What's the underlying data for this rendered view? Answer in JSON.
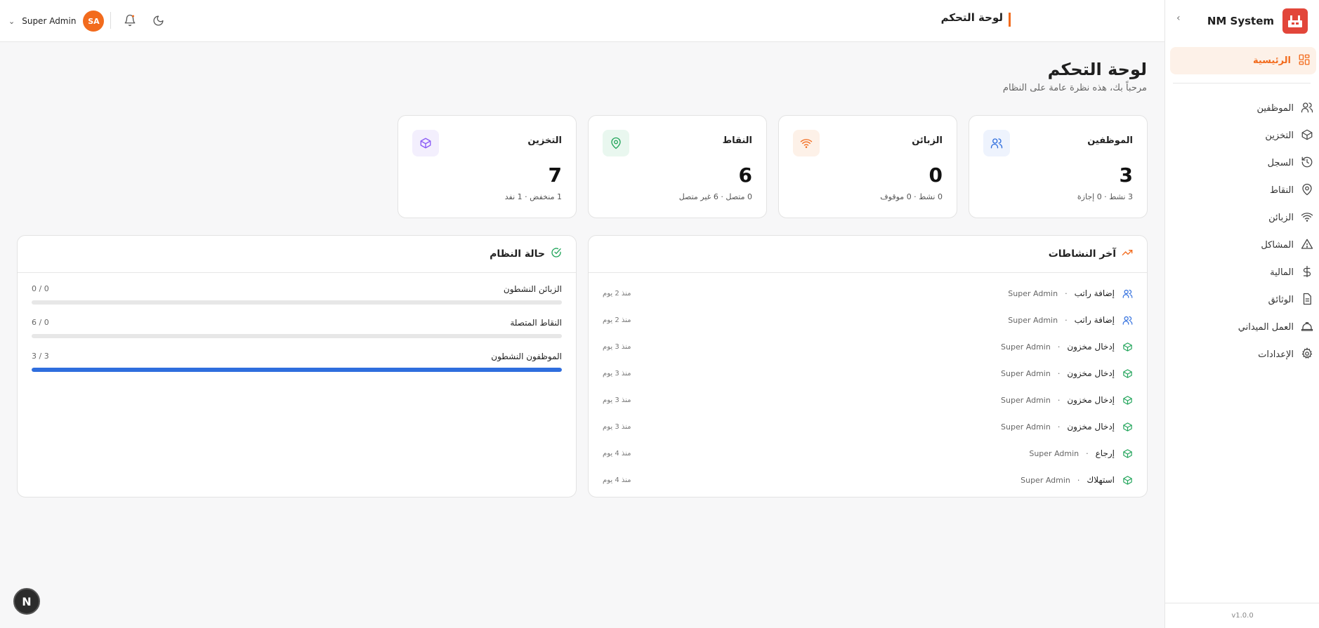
{
  "header": {
    "user_name": "Super Admin",
    "avatar_initials": "SA",
    "page_label": "لوحة التحكم"
  },
  "sidebar": {
    "brand": "NM System",
    "version": "v1.0.0",
    "items": [
      {
        "label": "الرئيسية",
        "icon": "dashboard-icon",
        "active": true
      },
      {
        "label": "الموظفين",
        "icon": "users-icon"
      },
      {
        "label": "التخزين",
        "icon": "box-icon"
      },
      {
        "label": "السجل",
        "icon": "history-icon"
      },
      {
        "label": "النقاط",
        "icon": "map-pin-icon"
      },
      {
        "label": "الزبائن",
        "icon": "wifi-icon"
      },
      {
        "label": "المشاكل",
        "icon": "alert-triangle-icon"
      },
      {
        "label": "المالية",
        "icon": "dollar-icon"
      },
      {
        "label": "الوثائق",
        "icon": "document-icon"
      },
      {
        "label": "العمل الميداني",
        "icon": "hard-hat-icon"
      },
      {
        "label": "الإعدادات",
        "icon": "gear-icon"
      }
    ]
  },
  "main": {
    "title": "لوحة التحكم",
    "subtitle": "مرحباً بك، هذه نظرة عامة على النظام"
  },
  "stats": [
    {
      "label": "الموظفين",
      "value": "3",
      "sub": "3 نشط · 0 إجازة",
      "icon": "users-icon",
      "color": "#2f6ede",
      "bg": "#eef3fd"
    },
    {
      "label": "الزبائن",
      "value": "0",
      "sub": "0 نشط · 0 موقوف",
      "icon": "wifi-icon",
      "color": "#f26b1d",
      "bg": "#fdf1e8"
    },
    {
      "label": "النقاط",
      "value": "6",
      "sub": "0 متصل · 6 غير متصل",
      "icon": "map-pin-icon",
      "color": "#22a55b",
      "bg": "#e9f7ef"
    },
    {
      "label": "التخزين",
      "value": "7",
      "sub": "1 منخفض · 1 نفد",
      "icon": "box-icon",
      "color": "#8b5cf6",
      "bg": "#f3effd"
    }
  ],
  "activity": {
    "title": "آخر النشاطات",
    "items": [
      {
        "action": "إضافة راتب",
        "user": "Super Admin",
        "time": "منذ 2 يوم",
        "icon": "users-icon"
      },
      {
        "action": "إضافة راتب",
        "user": "Super Admin",
        "time": "منذ 2 يوم",
        "icon": "users-icon"
      },
      {
        "action": "إدخال مخزون",
        "user": "Super Admin",
        "time": "منذ 3 يوم",
        "icon": "box-icon"
      },
      {
        "action": "إدخال مخزون",
        "user": "Super Admin",
        "time": "منذ 3 يوم",
        "icon": "box-icon"
      },
      {
        "action": "إدخال مخزون",
        "user": "Super Admin",
        "time": "منذ 3 يوم",
        "icon": "box-icon"
      },
      {
        "action": "إدخال مخزون",
        "user": "Super Admin",
        "time": "منذ 3 يوم",
        "icon": "box-icon"
      },
      {
        "action": "إرجاع",
        "user": "Super Admin",
        "time": "منذ 4 يوم",
        "icon": "box-icon"
      },
      {
        "action": "استهلاك",
        "user": "Super Admin",
        "time": "منذ 4 يوم",
        "icon": "box-icon"
      }
    ]
  },
  "system_status": {
    "title": "حالة النظام",
    "rows": [
      {
        "label": "الزبائن النشطون",
        "count": "0 / 0",
        "progress": 0
      },
      {
        "label": "النقاط المتصلة",
        "count": "6 / 0",
        "progress": 0
      },
      {
        "label": "الموظفون النشطون",
        "count": "3 / 3",
        "progress": 1
      }
    ]
  },
  "fab_label": "N"
}
